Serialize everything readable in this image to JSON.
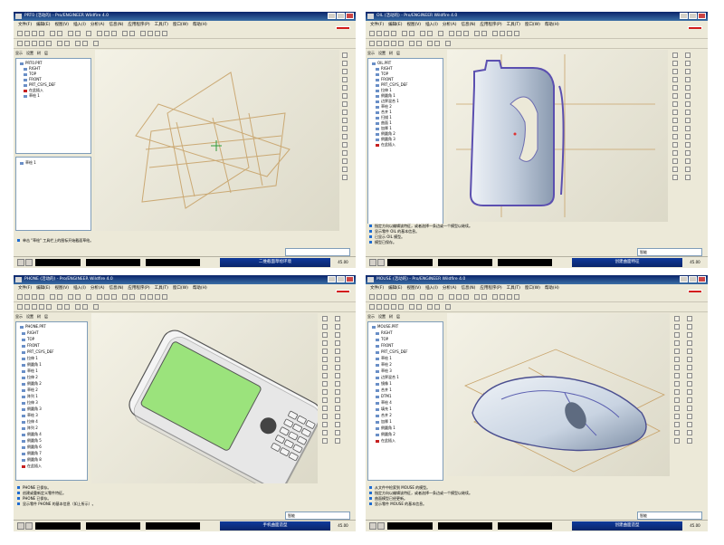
{
  "panels": [
    {
      "window_title": "PRT0 (活动的) - Pro/ENGINEER Wildfire 4.0",
      "menus": [
        "文件(F)",
        "编辑(E)",
        "视图(V)",
        "插入(I)",
        "分析(A)",
        "信息(N)",
        "应用程序(P)",
        "工具(T)",
        "窗口(W)",
        "帮助(H)"
      ],
      "left_tabs": [
        "显示",
        "设置",
        "树",
        "层"
      ],
      "tree_items": [
        {
          "label": "PRT0.PRT",
          "mark": "normal"
        },
        {
          "label": "RIGHT",
          "mark": "normal"
        },
        {
          "label": "TOP",
          "mark": "normal"
        },
        {
          "label": "FRONT",
          "mark": "normal"
        },
        {
          "label": "PRT_CSYS_DEF",
          "mark": "normal"
        },
        {
          "label": "在此插入",
          "mark": "red"
        },
        {
          "label": "草绘 1",
          "mark": "normal"
        }
      ],
      "lower_tree_item": "草绘 1",
      "messages": [
        "单击 \"草绘\" 工具栏上的图标开始截面草绘。"
      ],
      "filter_value": "",
      "status_label": "二维截面草绘环境",
      "zoom_text": "45.00"
    },
    {
      "window_title": "OIL (活动的) - Pro/ENGINEER Wildfire 4.0",
      "menus": [
        "文件(F)",
        "编辑(E)",
        "视图(V)",
        "插入(I)",
        "分析(A)",
        "信息(N)",
        "应用程序(P)",
        "工具(T)",
        "窗口(W)",
        "帮助(H)"
      ],
      "left_tabs": [
        "显示",
        "设置",
        "树",
        "层"
      ],
      "tree_items": [
        {
          "label": "OIL.PRT",
          "mark": "normal"
        },
        {
          "label": "RIGHT",
          "mark": "normal"
        },
        {
          "label": "TOP",
          "mark": "normal"
        },
        {
          "label": "FRONT",
          "mark": "normal"
        },
        {
          "label": "PRT_CSYS_DEF",
          "mark": "normal"
        },
        {
          "label": "拉伸 1",
          "mark": "normal"
        },
        {
          "label": "倒圆角 1",
          "mark": "normal"
        },
        {
          "label": "边界混合 1",
          "mark": "normal"
        },
        {
          "label": "草绘 2",
          "mark": "normal"
        },
        {
          "label": "合并 1",
          "mark": "normal"
        },
        {
          "label": "扫描 1",
          "mark": "normal"
        },
        {
          "label": "曲面 1",
          "mark": "normal"
        },
        {
          "label": "加厚 1",
          "mark": "normal"
        },
        {
          "label": "倒圆角 2",
          "mark": "normal"
        },
        {
          "label": "倒圆角 3",
          "mark": "normal"
        },
        {
          "label": "在此插入",
          "mark": "red"
        }
      ],
      "lower_tree_item": "",
      "messages": [
        "指定方向以编辑该特征，或者选择一条边或一个模型以继续。",
        "显示零件 OIL 的基本信息。",
        "已显示 OIL 模型。",
        "模型已保存。"
      ],
      "filter_value": "智能",
      "status_label": "创建曲面特征",
      "zoom_text": "45.00"
    },
    {
      "window_title": "PHONE (活动的) - Pro/ENGINEER Wildfire 4.0",
      "menus": [
        "文件(F)",
        "编辑(E)",
        "视图(V)",
        "插入(I)",
        "分析(A)",
        "信息(N)",
        "应用程序(P)",
        "工具(T)",
        "窗口(W)",
        "帮助(H)"
      ],
      "left_tabs": [
        "显示",
        "设置",
        "树",
        "层"
      ],
      "tree_items": [
        {
          "label": "PHONE.PRT",
          "mark": "normal"
        },
        {
          "label": "RIGHT",
          "mark": "normal"
        },
        {
          "label": "TOP",
          "mark": "normal"
        },
        {
          "label": "FRONT",
          "mark": "normal"
        },
        {
          "label": "PRT_CSYS_DEF",
          "mark": "normal"
        },
        {
          "label": "拉伸 1",
          "mark": "normal"
        },
        {
          "label": "倒圆角 1",
          "mark": "normal"
        },
        {
          "label": "草绘 1",
          "mark": "normal"
        },
        {
          "label": "拉伸 2",
          "mark": "normal"
        },
        {
          "label": "倒圆角 2",
          "mark": "normal"
        },
        {
          "label": "草绘 2",
          "mark": "normal"
        },
        {
          "label": "阵列 1",
          "mark": "normal"
        },
        {
          "label": "拉伸 3",
          "mark": "normal"
        },
        {
          "label": "倒圆角 3",
          "mark": "normal"
        },
        {
          "label": "草绘 3",
          "mark": "normal"
        },
        {
          "label": "拉伸 4",
          "mark": "normal"
        },
        {
          "label": "阵列 2",
          "mark": "normal"
        },
        {
          "label": "倒圆角 4",
          "mark": "normal"
        },
        {
          "label": "倒圆角 5",
          "mark": "normal"
        },
        {
          "label": "倒圆角 6",
          "mark": "normal"
        },
        {
          "label": "倒圆角 7",
          "mark": "normal"
        },
        {
          "label": "倒圆角 8",
          "mark": "normal"
        },
        {
          "label": "在此插入",
          "mark": "red"
        }
      ],
      "lower_tree_item": "",
      "messages": [
        "PHONE 已保存。",
        "创建或重新定义零件特征。",
        "PHONE 已保存。",
        "显示零件 PHONE 的基本信息（如上所示）。"
      ],
      "filter_value": "智能",
      "status_label": "手机曲面造型",
      "zoom_text": "45.00"
    },
    {
      "window_title": "MOUSE (活动的) - Pro/ENGINEER Wildfire 4.0",
      "menus": [
        "文件(F)",
        "编辑(E)",
        "视图(V)",
        "插入(I)",
        "分析(A)",
        "信息(N)",
        "应用程序(P)",
        "工具(T)",
        "窗口(W)",
        "帮助(H)"
      ],
      "left_tabs": [
        "显示",
        "设置",
        "树",
        "层"
      ],
      "tree_items": [
        {
          "label": "MOUSE.PRT",
          "mark": "normal"
        },
        {
          "label": "RIGHT",
          "mark": "normal"
        },
        {
          "label": "TOP",
          "mark": "normal"
        },
        {
          "label": "FRONT",
          "mark": "normal"
        },
        {
          "label": "PRT_CSYS_DEF",
          "mark": "normal"
        },
        {
          "label": "草绘 1",
          "mark": "normal"
        },
        {
          "label": "草绘 2",
          "mark": "normal"
        },
        {
          "label": "草绘 3",
          "mark": "normal"
        },
        {
          "label": "边界混合 1",
          "mark": "normal"
        },
        {
          "label": "镜像 1",
          "mark": "normal"
        },
        {
          "label": "合并 1",
          "mark": "normal"
        },
        {
          "label": "DTM1",
          "mark": "normal"
        },
        {
          "label": "草绘 4",
          "mark": "normal"
        },
        {
          "label": "填充 1",
          "mark": "normal"
        },
        {
          "label": "合并 2",
          "mark": "normal"
        },
        {
          "label": "加厚 1",
          "mark": "normal"
        },
        {
          "label": "倒圆角 1",
          "mark": "normal"
        },
        {
          "label": "倒圆角 2",
          "mark": "normal"
        },
        {
          "label": "在此插入",
          "mark": "red"
        }
      ],
      "lower_tree_item": "",
      "messages": [
        "从文件中检索到 MOUSE 的模型。",
        "指定方向以编辑该特征，或者选择一条边或一个模型以继续。",
        "曲面模型已经更新。",
        "显示零件 MOUSE 的基本信息。"
      ],
      "filter_value": "智能",
      "status_label": "创建曲面造型",
      "zoom_text": "45.00"
    }
  ],
  "colors": {
    "title_blue": "#0a246a",
    "chrome": "#ece9d8",
    "sketch_lines": "#c8a36a",
    "surface_blue": "#c9d4e2",
    "screen_green": "#9be37c"
  }
}
